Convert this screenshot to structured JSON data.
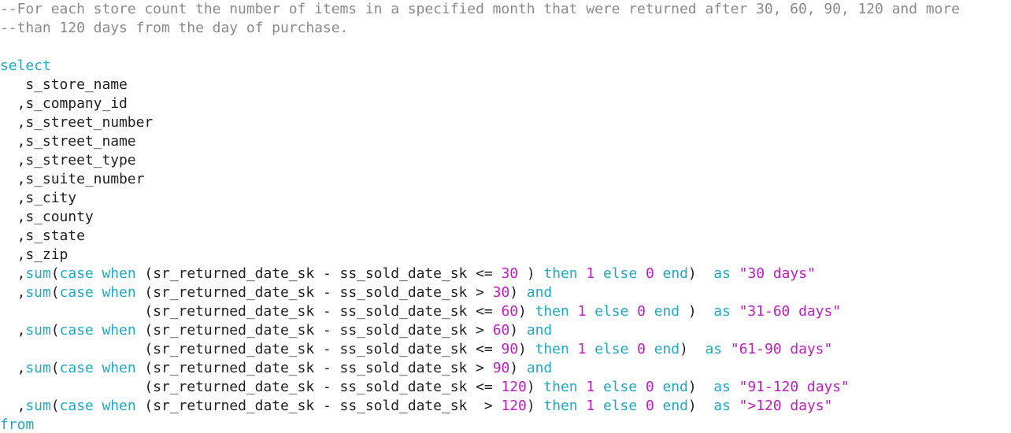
{
  "editor": {
    "colors": {
      "background": "#ffffff",
      "comment": "#8a8a8a",
      "keyword": "#1fa9c6",
      "number": "#c21cc4",
      "string": "#c21cc4",
      "plain": "#222222"
    },
    "lines": [
      {
        "tokens": [
          {
            "t": "comment",
            "v": "--For each store count the number of items in a specified month that were returned after 30, 60, 90, 120 and more"
          }
        ]
      },
      {
        "tokens": [
          {
            "t": "comment",
            "v": "--than 120 days from the day of purchase."
          }
        ]
      },
      {
        "tokens": []
      },
      {
        "tokens": [
          {
            "t": "keyword",
            "v": "select"
          }
        ]
      },
      {
        "tokens": [
          {
            "t": "plain",
            "v": "   s_store_name"
          }
        ]
      },
      {
        "tokens": [
          {
            "t": "plain",
            "v": "  ,s_company_id"
          }
        ]
      },
      {
        "tokens": [
          {
            "t": "plain",
            "v": "  ,s_street_number"
          }
        ]
      },
      {
        "tokens": [
          {
            "t": "plain",
            "v": "  ,s_street_name"
          }
        ]
      },
      {
        "tokens": [
          {
            "t": "plain",
            "v": "  ,s_street_type"
          }
        ]
      },
      {
        "tokens": [
          {
            "t": "plain",
            "v": "  ,s_suite_number"
          }
        ]
      },
      {
        "tokens": [
          {
            "t": "plain",
            "v": "  ,s_city"
          }
        ]
      },
      {
        "tokens": [
          {
            "t": "plain",
            "v": "  ,s_county"
          }
        ]
      },
      {
        "tokens": [
          {
            "t": "plain",
            "v": "  ,s_state"
          }
        ]
      },
      {
        "tokens": [
          {
            "t": "plain",
            "v": "  ,s_zip"
          }
        ]
      },
      {
        "tokens": [
          {
            "t": "plain",
            "v": "  ,"
          },
          {
            "t": "keyword",
            "v": "sum"
          },
          {
            "t": "plain",
            "v": "("
          },
          {
            "t": "keyword",
            "v": "case when"
          },
          {
            "t": "plain",
            "v": " (sr_returned_date_sk - ss_sold_date_sk <= "
          },
          {
            "t": "number",
            "v": "30"
          },
          {
            "t": "plain",
            "v": " ) "
          },
          {
            "t": "keyword",
            "v": "then"
          },
          {
            "t": "plain",
            "v": " "
          },
          {
            "t": "number",
            "v": "1"
          },
          {
            "t": "plain",
            "v": " "
          },
          {
            "t": "keyword",
            "v": "else"
          },
          {
            "t": "plain",
            "v": " "
          },
          {
            "t": "number",
            "v": "0"
          },
          {
            "t": "plain",
            "v": " "
          },
          {
            "t": "keyword",
            "v": "end"
          },
          {
            "t": "plain",
            "v": ")  "
          },
          {
            "t": "keyword",
            "v": "as"
          },
          {
            "t": "plain",
            "v": " "
          },
          {
            "t": "string",
            "v": "\"30 days\""
          }
        ]
      },
      {
        "tokens": [
          {
            "t": "plain",
            "v": "  ,"
          },
          {
            "t": "keyword",
            "v": "sum"
          },
          {
            "t": "plain",
            "v": "("
          },
          {
            "t": "keyword",
            "v": "case when"
          },
          {
            "t": "plain",
            "v": " (sr_returned_date_sk - ss_sold_date_sk > "
          },
          {
            "t": "number",
            "v": "30"
          },
          {
            "t": "plain",
            "v": ") "
          },
          {
            "t": "keyword",
            "v": "and"
          }
        ]
      },
      {
        "tokens": [
          {
            "t": "plain",
            "v": "                 (sr_returned_date_sk - ss_sold_date_sk <= "
          },
          {
            "t": "number",
            "v": "60"
          },
          {
            "t": "plain",
            "v": ") "
          },
          {
            "t": "keyword",
            "v": "then"
          },
          {
            "t": "plain",
            "v": " "
          },
          {
            "t": "number",
            "v": "1"
          },
          {
            "t": "plain",
            "v": " "
          },
          {
            "t": "keyword",
            "v": "else"
          },
          {
            "t": "plain",
            "v": " "
          },
          {
            "t": "number",
            "v": "0"
          },
          {
            "t": "plain",
            "v": " "
          },
          {
            "t": "keyword",
            "v": "end"
          },
          {
            "t": "plain",
            "v": " )  "
          },
          {
            "t": "keyword",
            "v": "as"
          },
          {
            "t": "plain",
            "v": " "
          },
          {
            "t": "string",
            "v": "\"31-60 days\""
          }
        ]
      },
      {
        "tokens": [
          {
            "t": "plain",
            "v": "  ,"
          },
          {
            "t": "keyword",
            "v": "sum"
          },
          {
            "t": "plain",
            "v": "("
          },
          {
            "t": "keyword",
            "v": "case when"
          },
          {
            "t": "plain",
            "v": " (sr_returned_date_sk - ss_sold_date_sk > "
          },
          {
            "t": "number",
            "v": "60"
          },
          {
            "t": "plain",
            "v": ") "
          },
          {
            "t": "keyword",
            "v": "and"
          }
        ]
      },
      {
        "tokens": [
          {
            "t": "plain",
            "v": "                 (sr_returned_date_sk - ss_sold_date_sk <= "
          },
          {
            "t": "number",
            "v": "90"
          },
          {
            "t": "plain",
            "v": ") "
          },
          {
            "t": "keyword",
            "v": "then"
          },
          {
            "t": "plain",
            "v": " "
          },
          {
            "t": "number",
            "v": "1"
          },
          {
            "t": "plain",
            "v": " "
          },
          {
            "t": "keyword",
            "v": "else"
          },
          {
            "t": "plain",
            "v": " "
          },
          {
            "t": "number",
            "v": "0"
          },
          {
            "t": "plain",
            "v": " "
          },
          {
            "t": "keyword",
            "v": "end"
          },
          {
            "t": "plain",
            "v": ")  "
          },
          {
            "t": "keyword",
            "v": "as"
          },
          {
            "t": "plain",
            "v": " "
          },
          {
            "t": "string",
            "v": "\"61-90 days\""
          }
        ]
      },
      {
        "tokens": [
          {
            "t": "plain",
            "v": "  ,"
          },
          {
            "t": "keyword",
            "v": "sum"
          },
          {
            "t": "plain",
            "v": "("
          },
          {
            "t": "keyword",
            "v": "case when"
          },
          {
            "t": "plain",
            "v": " (sr_returned_date_sk - ss_sold_date_sk > "
          },
          {
            "t": "number",
            "v": "90"
          },
          {
            "t": "plain",
            "v": ") "
          },
          {
            "t": "keyword",
            "v": "and"
          }
        ]
      },
      {
        "tokens": [
          {
            "t": "plain",
            "v": "                 (sr_returned_date_sk - ss_sold_date_sk <= "
          },
          {
            "t": "number",
            "v": "120"
          },
          {
            "t": "plain",
            "v": ") "
          },
          {
            "t": "keyword",
            "v": "then"
          },
          {
            "t": "plain",
            "v": " "
          },
          {
            "t": "number",
            "v": "1"
          },
          {
            "t": "plain",
            "v": " "
          },
          {
            "t": "keyword",
            "v": "else"
          },
          {
            "t": "plain",
            "v": " "
          },
          {
            "t": "number",
            "v": "0"
          },
          {
            "t": "plain",
            "v": " "
          },
          {
            "t": "keyword",
            "v": "end"
          },
          {
            "t": "plain",
            "v": ")  "
          },
          {
            "t": "keyword",
            "v": "as"
          },
          {
            "t": "plain",
            "v": " "
          },
          {
            "t": "string",
            "v": "\"91-120 days\""
          }
        ]
      },
      {
        "tokens": [
          {
            "t": "plain",
            "v": "  ,"
          },
          {
            "t": "keyword",
            "v": "sum"
          },
          {
            "t": "plain",
            "v": "("
          },
          {
            "t": "keyword",
            "v": "case when"
          },
          {
            "t": "plain",
            "v": " (sr_returned_date_sk - ss_sold_date_sk  > "
          },
          {
            "t": "number",
            "v": "120"
          },
          {
            "t": "plain",
            "v": ") "
          },
          {
            "t": "keyword",
            "v": "then"
          },
          {
            "t": "plain",
            "v": " "
          },
          {
            "t": "number",
            "v": "1"
          },
          {
            "t": "plain",
            "v": " "
          },
          {
            "t": "keyword",
            "v": "else"
          },
          {
            "t": "plain",
            "v": " "
          },
          {
            "t": "number",
            "v": "0"
          },
          {
            "t": "plain",
            "v": " "
          },
          {
            "t": "keyword",
            "v": "end"
          },
          {
            "t": "plain",
            "v": ")  "
          },
          {
            "t": "keyword",
            "v": "as"
          },
          {
            "t": "plain",
            "v": " "
          },
          {
            "t": "string",
            "v": "\">120 days\""
          }
        ]
      },
      {
        "tokens": [
          {
            "t": "keyword",
            "v": "from"
          }
        ]
      }
    ]
  }
}
